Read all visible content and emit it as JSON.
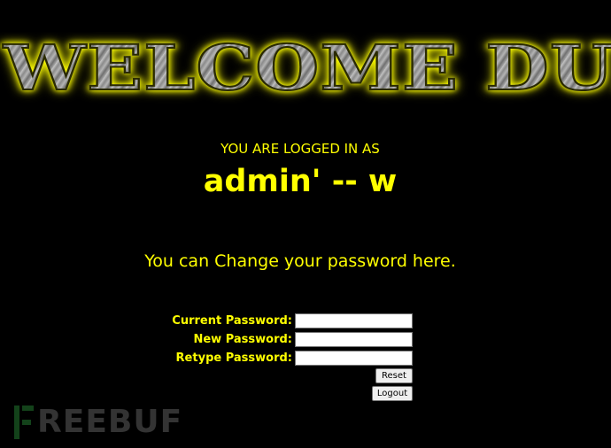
{
  "banner": {
    "text": "WELCOME DUMB"
  },
  "status": {
    "logged_in_label": "YOU ARE LOGGED IN AS",
    "username": "admin' -- w"
  },
  "change_message": "You can Change your password here.",
  "form": {
    "current_password_label": "Current Password:",
    "new_password_label": "New Password:",
    "retype_password_label": "Retype Password:",
    "current_password_value": "",
    "new_password_value": "",
    "retype_password_value": "",
    "reset_label": "Reset",
    "logout_label": "Logout"
  },
  "watermark": {
    "text": "REEBUF",
    "mark_icon": "freebuf-f-logo-icon"
  },
  "colors": {
    "background": "#000000",
    "text": "#ffff00",
    "banner_glow": "#ffff00"
  }
}
